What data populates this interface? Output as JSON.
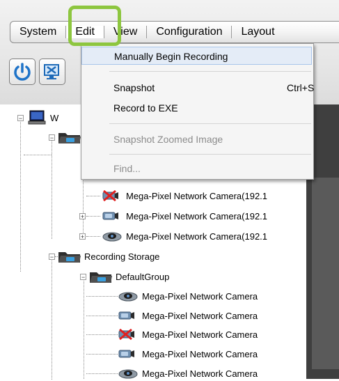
{
  "menubar": {
    "items": [
      {
        "label": "System"
      },
      {
        "label": "Edit"
      },
      {
        "label": "View"
      },
      {
        "label": "Configuration"
      },
      {
        "label": "Layout"
      }
    ]
  },
  "toolbar": {
    "buttons": [
      {
        "icon": "power-icon"
      },
      {
        "icon": "monitor-x-icon"
      }
    ]
  },
  "edit_menu": {
    "items": [
      {
        "label": "Manually Begin Recording",
        "shortcut": "",
        "enabled": true,
        "hovered": true
      },
      {
        "label": "Snapshot",
        "shortcut": "Ctrl+S",
        "enabled": true
      },
      {
        "label": "Record to EXE",
        "shortcut": "",
        "enabled": true
      },
      {
        "label": "Snapshot Zoomed Image",
        "shortcut": "",
        "enabled": false
      },
      {
        "label": "Find...",
        "shortcut": "",
        "enabled": false
      }
    ]
  },
  "tree": {
    "root_label_partial": "W",
    "cameras_group_a": [
      {
        "label": "Mega-Pixel Network Camera(192.1",
        "icon": "camera-disconnected-icon"
      },
      {
        "label": "Mega-Pixel Network Camera(192.1",
        "icon": "camera-box-icon"
      },
      {
        "label": "Mega-Pixel Network Camera(192.1",
        "icon": "camera-dome-icon"
      }
    ],
    "recording_storage": {
      "label": "Recording Storage",
      "group": {
        "label": "DefaultGroup",
        "cameras": [
          {
            "label": "Mega-Pixel Network Camera",
            "icon": "camera-dome-icon"
          },
          {
            "label": "Mega-Pixel Network Camera",
            "icon": "camera-box-icon"
          },
          {
            "label": "Mega-Pixel Network Camera",
            "icon": "camera-disconnected-icon"
          },
          {
            "label": "Mega-Pixel Network Camera",
            "icon": "camera-box-icon"
          },
          {
            "label": "Mega-Pixel Network Camera",
            "icon": "camera-dome-icon"
          }
        ]
      }
    }
  },
  "colors": {
    "highlight": "#8dc63f",
    "menu_hover": "#e4ecf7"
  }
}
